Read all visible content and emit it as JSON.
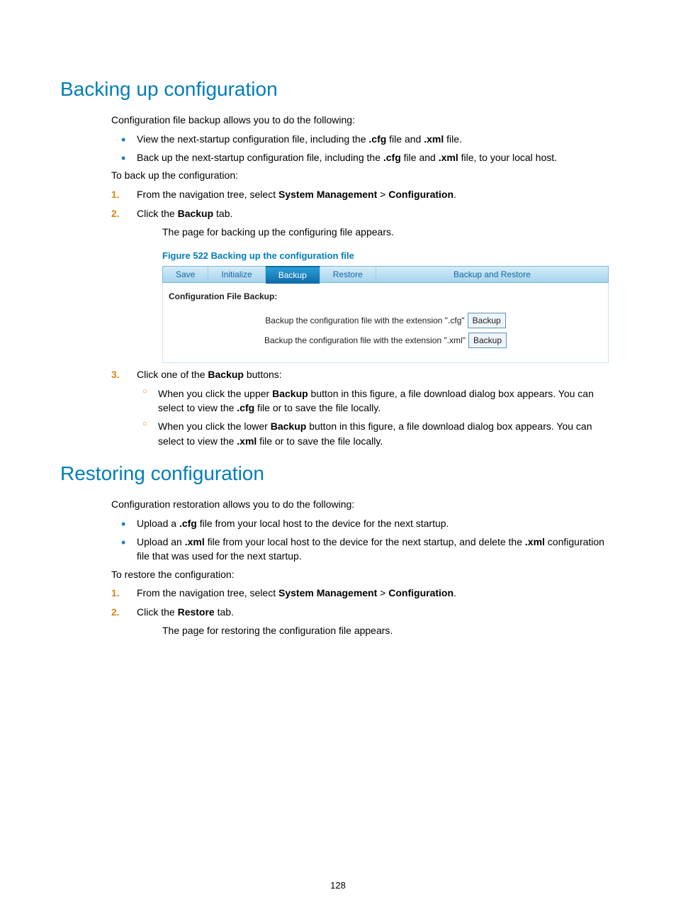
{
  "section1": {
    "heading": "Backing up configuration",
    "intro": "Configuration file backup allows you to do the following:",
    "bullets": {
      "b1_prefix": "View the next-startup configuration file, including the ",
      "b1_bold1": ".cfg",
      "b1_mid": " file and ",
      "b1_bold2": ".xml",
      "b1_suffix": " file.",
      "b2_prefix": "Back up the next-startup configuration file, including the ",
      "b2_bold1": ".cfg",
      "b2_mid": " file and ",
      "b2_bold2": ".xml",
      "b2_suffix": " file, to your local host."
    },
    "lead2": "To back up the configuration:",
    "step1_prefix": "From the navigation tree, select ",
    "step1_bold1": "System Management",
    "step1_mid": " > ",
    "step1_bold2": "Configuration",
    "step1_suffix": ".",
    "step2_prefix": "Click the ",
    "step2_bold": "Backup",
    "step2_suffix": " tab.",
    "step2_after": "The page for backing up the configuring file appears.",
    "figcaption": "Figure 522 Backing up the configuration file",
    "step3_prefix": "Click one of the ",
    "step3_bold": "Backup",
    "step3_suffix": " buttons:",
    "sub1_prefix": "When you click the upper ",
    "sub1_bold1": "Backup",
    "sub1_mid": " button in this figure, a file download dialog box appears. You can select to view the ",
    "sub1_bold2": ".cfg",
    "sub1_suffix": " file or to save the file locally.",
    "sub2_prefix": "When you click the lower ",
    "sub2_bold1": "Backup",
    "sub2_mid": " button in this figure, a file download dialog box appears. You can select to view the ",
    "sub2_bold2": ".xml",
    "sub2_suffix": " file or to save the file locally."
  },
  "figure": {
    "tabs": {
      "save": "Save",
      "initialize": "Initialize",
      "backup": "Backup",
      "restore": "Restore",
      "backup_restore": "Backup and Restore"
    },
    "section_title": "Configuration File Backup:",
    "row1_label": "Backup the configuration file with the extension \".cfg\"",
    "row2_label": "Backup the configuration file with the extension \".xml\"",
    "button_label": "Backup"
  },
  "section2": {
    "heading": "Restoring configuration",
    "intro": "Configuration restoration allows you to do the following:",
    "b1_prefix": "Upload a ",
    "b1_bold": ".cfg",
    "b1_suffix": " file from your local host to the device for the next startup.",
    "b2_prefix": "Upload an ",
    "b2_bold1": ".xml",
    "b2_mid": " file from your local host to the device for the next startup, and delete the ",
    "b2_bold2": ".xml",
    "b2_suffix": " configuration file that was used for the next startup.",
    "lead2": "To restore the configuration:",
    "step1_prefix": "From the navigation tree, select ",
    "step1_bold1": "System Management",
    "step1_mid": " > ",
    "step1_bold2": "Configuration",
    "step1_suffix": ".",
    "step2_prefix": "Click the ",
    "step2_bold": "Restore",
    "step2_suffix": " tab.",
    "step2_after": "The page for restoring the configuration file appears."
  },
  "page_number": "128"
}
